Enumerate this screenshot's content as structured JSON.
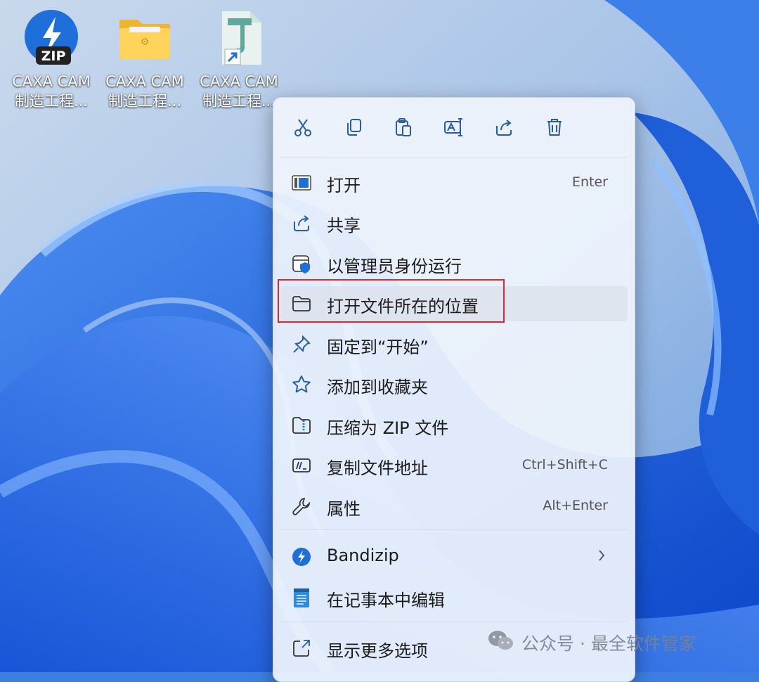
{
  "desktop": {
    "icons": [
      {
        "name": "CAXA CAM",
        "sub": "制造工程...",
        "badge": "ZIP"
      },
      {
        "name": "CAXA CAM",
        "sub": "制造工程..."
      },
      {
        "name": "CAXA CAM",
        "sub": "制造工程..."
      }
    ]
  },
  "menu": {
    "toolbar": [
      "cut-icon",
      "copy-icon",
      "paste-icon",
      "rename-icon",
      "share-icon",
      "delete-icon"
    ],
    "items": [
      {
        "label": "打开",
        "shortcut": "Enter"
      },
      {
        "label": "共享"
      },
      {
        "label": "以管理员身份运行"
      },
      {
        "label": "打开文件所在的位置"
      },
      {
        "label": "固定到“开始”"
      },
      {
        "label": "添加到收藏夹"
      },
      {
        "label": "压缩为 ZIP 文件"
      },
      {
        "label": "复制文件地址",
        "shortcut": "Ctrl+Shift+C"
      },
      {
        "label": "属性",
        "shortcut": "Alt+Enter"
      },
      {
        "label": "Bandizip"
      },
      {
        "label": "在记事本中编辑"
      },
      {
        "label": "显示更多选项"
      }
    ]
  },
  "watermark": {
    "text": "公众号 · 最全软件管家"
  },
  "colors": {
    "accent": "#2f6fd6",
    "highlight_border": "#e0262a",
    "menu_bg": "#eff4fc"
  }
}
